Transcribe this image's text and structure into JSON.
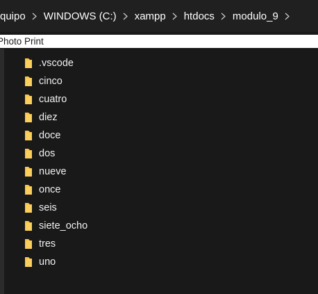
{
  "breadcrumb": [
    {
      "label": "quipo"
    },
    {
      "label": "WINDOWS (C:)"
    },
    {
      "label": "xampp"
    },
    {
      "label": "htdocs"
    },
    {
      "label": "modulo_9"
    }
  ],
  "banner": {
    "label": "Photo Print"
  },
  "folders": [
    {
      "name": ".vscode",
      "icon": "folder-icon"
    },
    {
      "name": "cinco",
      "icon": "folder-icon"
    },
    {
      "name": "cuatro",
      "icon": "folder-icon"
    },
    {
      "name": "diez",
      "icon": "folder-icon"
    },
    {
      "name": "doce",
      "icon": "folder-icon"
    },
    {
      "name": "dos",
      "icon": "folder-icon"
    },
    {
      "name": "nueve",
      "icon": "folder-icon"
    },
    {
      "name": "once",
      "icon": "folder-icon"
    },
    {
      "name": "seis",
      "icon": "folder-icon"
    },
    {
      "name": "siete_ocho",
      "icon": "folder-icon"
    },
    {
      "name": "tres",
      "icon": "folder-icon"
    },
    {
      "name": "uno",
      "icon": "folder-icon"
    }
  ],
  "colors": {
    "background": "#191919",
    "addressbar": "#202020",
    "folder": "#f7c64b",
    "text": "#f2f2f2"
  }
}
